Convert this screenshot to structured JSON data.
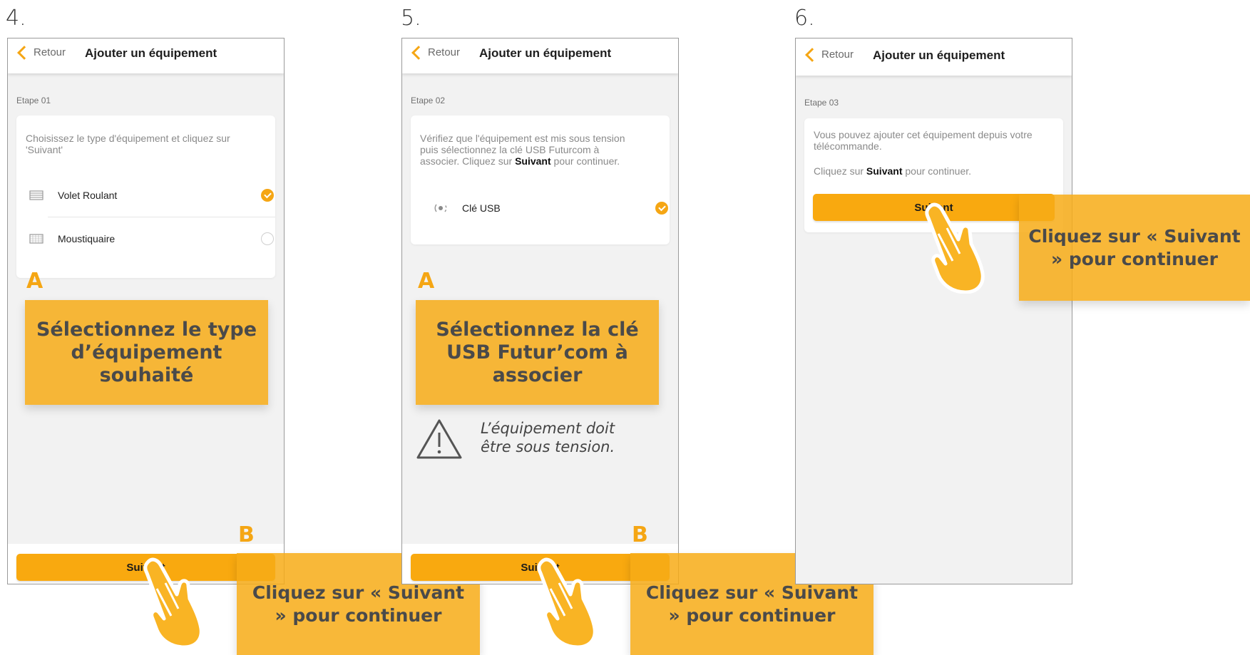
{
  "steps": [
    {
      "number": "4.",
      "back_label": "Retour",
      "title": "Ajouter un équipement",
      "etape": "Etape 01",
      "instruction": "Choisissez le type d'équipement et cliquez sur 'Suivant'",
      "options": [
        {
          "label": "Volet Roulant",
          "selected": true,
          "icon": "shutter-icon"
        },
        {
          "label": "Moustiquaire",
          "selected": false,
          "icon": "mosquito-net-icon"
        }
      ],
      "button_label": "Suivant",
      "callout_letter": "A",
      "callout_text": "Sélectionnez le type d’équipement souhaité",
      "button_letter": "B",
      "button_callout": "Cliquez sur « Suivant » pour continuer"
    },
    {
      "number": "5.",
      "back_label": "Retour",
      "title": "Ajouter un équipement",
      "etape": "Etape 02",
      "instruction_parts": [
        "Vérifiez que l'équipement est mis sous tension puis sélectionnez la clé USB Futurcom à associer. Cliquez sur ",
        "Suivant",
        " pour continuer."
      ],
      "options": [
        {
          "label": "Clé USB",
          "selected": true,
          "icon": "usb-key-icon"
        }
      ],
      "button_label": "Suivant",
      "callout_letter": "A",
      "callout_text": "Sélectionnez la clé USB Futur’com à associer",
      "warning_text": "L’équipement doit être  sous tension.",
      "button_letter": "B",
      "button_callout": "Cliquez sur « Suivant » pour continuer"
    },
    {
      "number": "6.",
      "back_label": "Retour",
      "title": "Ajouter un équipement",
      "etape": "Etape 03",
      "instruction_line1": "Vous pouvez ajouter cet équipement depuis votre télécommande.",
      "instruction_parts": [
        "Cliquez sur ",
        "Suivant",
        " pour continuer."
      ],
      "button_label": "Suivant",
      "button_callout": "Cliquez sur « Suivant » pour continuer"
    }
  ],
  "colors": {
    "accent": "#f9a90f",
    "callout": "#f7ac16",
    "background": "#f2f2f2"
  }
}
